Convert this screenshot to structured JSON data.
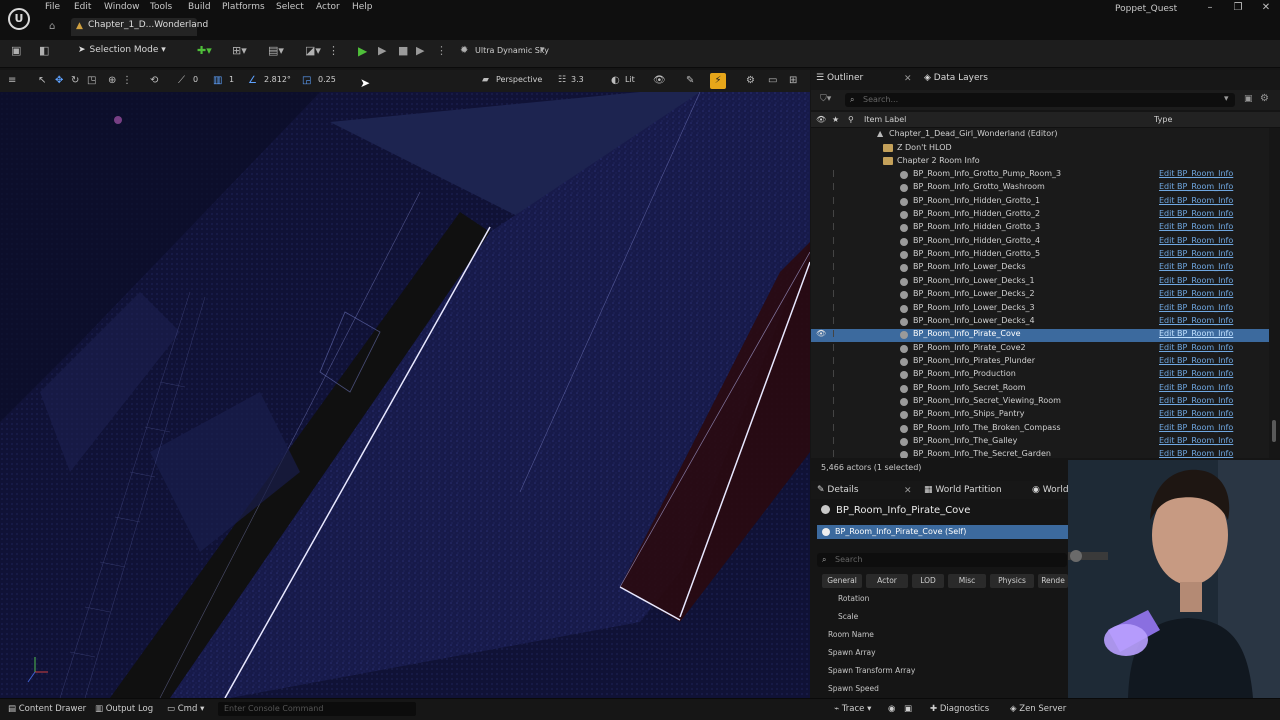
{
  "menu": {
    "items": [
      "File",
      "Edit",
      "Window",
      "Tools",
      "Build",
      "Platforms",
      "Select",
      "Actor",
      "Help"
    ],
    "project_name": "Poppet_Quest"
  },
  "document_tab": {
    "label": "Chapter_1_D...Wonderland"
  },
  "toolbar": {
    "selection_mode": "Selection Mode",
    "sky_label": "Ultra Dynamic Sky"
  },
  "viewport_toolbar": {
    "rotation_snap": "0",
    "grid_snap": "1",
    "camera_speed": "2.812°",
    "scale_snap": "0.25",
    "view_mode": "Perspective",
    "fov": "3.3",
    "lighting": "Lit"
  },
  "outliner": {
    "tabs": [
      "Outliner",
      "Data Layers"
    ],
    "search_placeholder": "Search...",
    "columns": {
      "label": "Item Label",
      "type": "Type"
    },
    "world_label": "Chapter_1_Dead_Girl_Wonderland (Editor)",
    "folders": [
      "Z Don't HLOD",
      "Chapter 2 Room Info"
    ],
    "type_value": "Edit BP_Room_Info",
    "items": [
      "BP_Room_Info_Grotto_Pump_Room_3",
      "BP_Room_Info_Grotto_Washroom",
      "BP_Room_Info_Hidden_Grotto_1",
      "BP_Room_Info_Hidden_Grotto_2",
      "BP_Room_Info_Hidden_Grotto_3",
      "BP_Room_Info_Hidden_Grotto_4",
      "BP_Room_Info_Hidden_Grotto_5",
      "BP_Room_Info_Lower_Decks",
      "BP_Room_Info_Lower_Decks_1",
      "BP_Room_Info_Lower_Decks_2",
      "BP_Room_Info_Lower_Decks_3",
      "BP_Room_Info_Lower_Decks_4",
      "BP_Room_Info_Pirate_Cove",
      "BP_Room_Info_Pirate_Cove2",
      "BP_Room_Info_Pirates_Plunder",
      "BP_Room_Info_Production",
      "BP_Room_Info_Secret_Room",
      "BP_Room_Info_Secret_Viewing_Room",
      "BP_Room_Info_Ships_Pantry",
      "BP_Room_Info_The_Broken_Compass",
      "BP_Room_Info_The_Galley",
      "BP_Room_Info_The_Secret_Garden"
    ],
    "selected_index": 12,
    "actor_count": "5,466 actors (1 selected)"
  },
  "details": {
    "tabs": [
      "Details",
      "World Partition",
      "World Settings"
    ],
    "title": "BP_Room_Info_Pirate_Cove",
    "self_row": "BP_Room_Info_Pirate_Cove (Self)",
    "search_placeholder": "Search",
    "filters": [
      "General",
      "Actor",
      "LOD",
      "Misc",
      "Physics",
      "Rende"
    ],
    "properties": [
      "Rotation",
      "Scale",
      "Room Name",
      "Spawn Array",
      "Spawn Transform Array",
      "Spawn Speed"
    ]
  },
  "statusbar": {
    "content_drawer": "Content Drawer",
    "output_log": "Output Log",
    "cmd": "Cmd",
    "console_placeholder": "Enter Console Command",
    "trace": "Trace",
    "diagnostics": "Diagnostics",
    "zen_server": "Zen Server"
  },
  "colors": {
    "selection": "#3c6a9e",
    "play_green": "#4fbf3a",
    "snap_orange": "#e6a61a",
    "link_blue": "#6fa7e0"
  }
}
